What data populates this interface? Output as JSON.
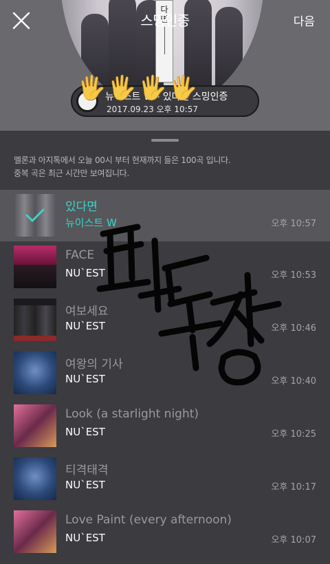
{
  "header": {
    "title": "스밍인증",
    "next_label": "다음",
    "disc_title": [
      "다",
      "면"
    ],
    "certificate": {
      "line1": "뉴이스트 W - 있다면 스밍인증",
      "line2": "2017.09.23 오후 10:57"
    }
  },
  "notice": {
    "line1": "멜론과 아지톡에서 오늘 00시 부터 현재까지 들은 100곡 입니다.",
    "line2": "중복 곡은 최근 시간만 보여집니다."
  },
  "songs": [
    {
      "title": "있다면",
      "artist": "뉴이스트 W",
      "time": "오후 10:57",
      "selected": true
    },
    {
      "title": "FACE",
      "artist": "NU`EST",
      "time": "오후 10:53"
    },
    {
      "title": "여보세요",
      "artist": "NU`EST",
      "time": "오후 10:46"
    },
    {
      "title": "여왕의 기사",
      "artist": "NU`EST",
      "time": "오후 10:40"
    },
    {
      "title": "Look (a starlight night)",
      "artist": "NU`EST",
      "time": "오후 10:25"
    },
    {
      "title": "티격태격",
      "artist": "NU`EST",
      "time": "오후 10:17"
    },
    {
      "title": "Love Paint (every afternoon)",
      "artist": "NU`EST",
      "time": "오후 10:07"
    }
  ],
  "colors": {
    "accent": "#39d5c9",
    "sheet_bg": "#3b3b40",
    "selected_row": "#56565b"
  },
  "icons": {
    "close": "close-icon",
    "check": "check-icon",
    "hands": "raised-hand-emoji"
  }
}
